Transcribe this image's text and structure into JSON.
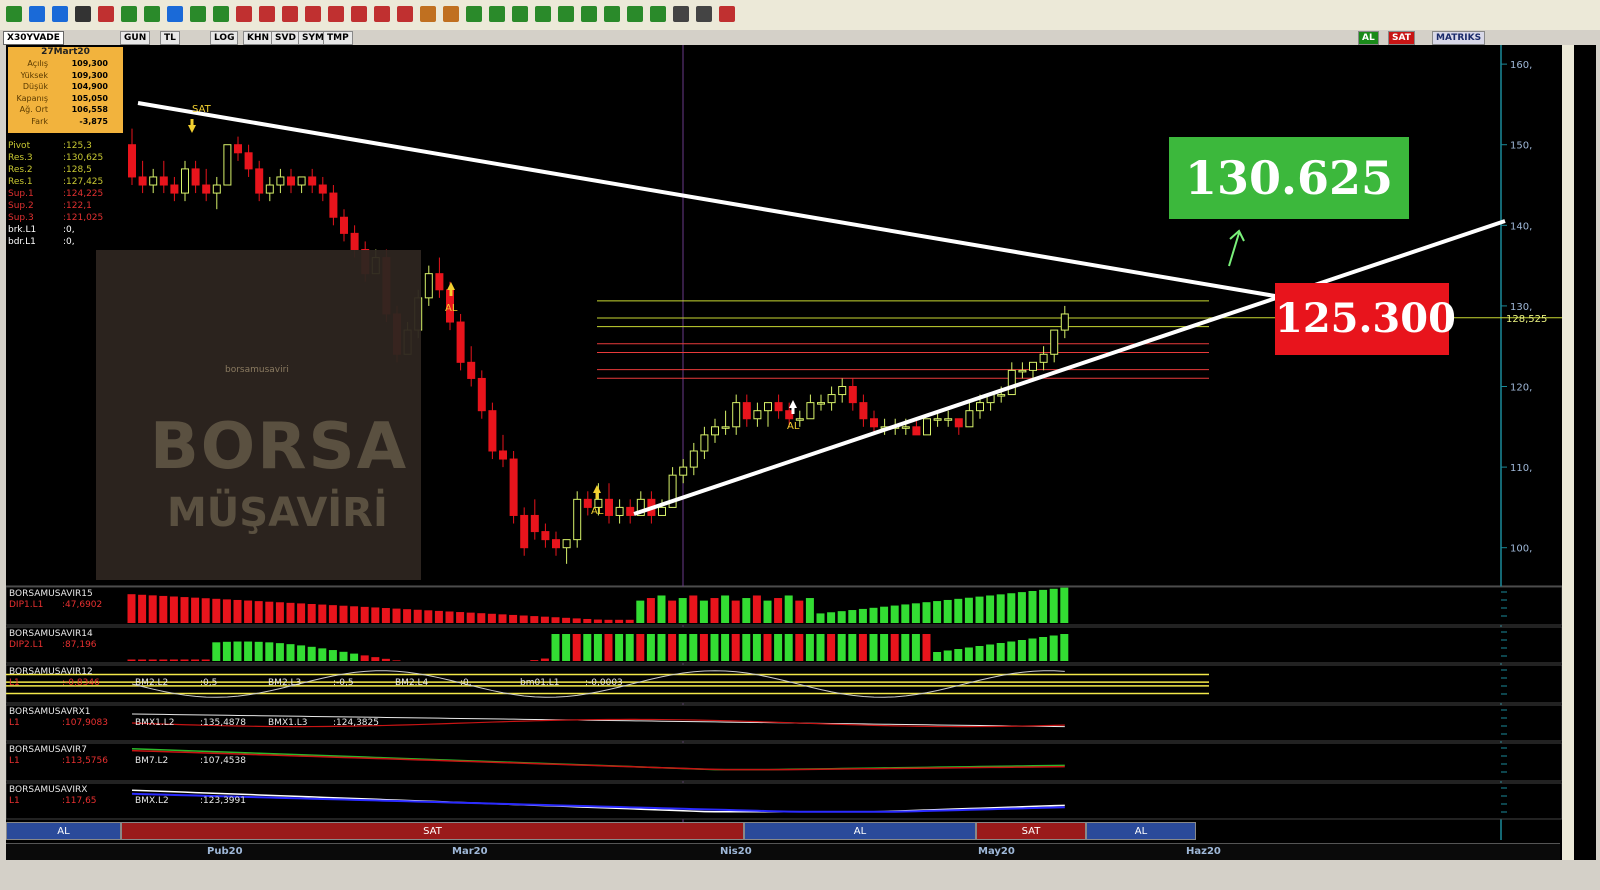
{
  "toolbar": {
    "icon_names": [
      "chart-icon",
      "cursor-icon",
      "crosshair-icon",
      "pencil-icon",
      "tools-icon",
      "trendline-icon",
      "fibonacci-icon",
      "channel-icon",
      "hline-icon",
      "vline-icon",
      "arc-icon",
      "brush-icon",
      "ruler-icon",
      "text-icon",
      "arrow-icon",
      "eraser-icon",
      "zoom-icon",
      "magnet-icon",
      "lock-icon",
      "bell-icon",
      "trash-icon",
      "print-icon",
      "move-icon",
      "grid-icon",
      "reset-icon",
      "left-icon",
      "right-icon",
      "up-icon",
      "down-icon",
      "search-icon",
      "settings-icon",
      "close-icon"
    ]
  },
  "menubar": {
    "symbol": "X30YVADE",
    "buttons": [
      "GUN",
      "TL",
      "LOG",
      "KHN",
      "SVD",
      "SYM",
      "TMP"
    ],
    "right_buttons": [
      "AL",
      "SAT",
      "MATRIKS"
    ]
  },
  "infobox": {
    "date": "27Mart20",
    "rows": [
      {
        "k": "Açılış",
        "v": "109,300"
      },
      {
        "k": "Yüksek",
        "v": "109,300"
      },
      {
        "k": "Düşük",
        "v": "104,900"
      },
      {
        "k": "Kapanış",
        "v": "105,050"
      },
      {
        "k": "Ağ. Ort",
        "v": "106,558"
      },
      {
        "k": "Fark",
        "v": "-3,875"
      }
    ]
  },
  "pivots": [
    {
      "k": "Pivot",
      "v": ":125,3",
      "color": "#c8c832"
    },
    {
      "k": "Res.3",
      "v": ":130,625",
      "color": "#c8c832"
    },
    {
      "k": "Res.2",
      "v": ":128,5",
      "color": "#c8c832"
    },
    {
      "k": "Res.1",
      "v": ":127,425",
      "color": "#c8c832"
    },
    {
      "k": "Sup.1",
      "v": ":124,225",
      "color": "#e03030"
    },
    {
      "k": "Sup.2",
      "v": ":122,1",
      "color": "#e03030"
    },
    {
      "k": "Sup.3",
      "v": ":121,025",
      "color": "#e03030"
    },
    {
      "k": "brk.L1",
      "v": ":0,",
      "color": "#ffffff"
    },
    {
      "k": "bdr.L1",
      "v": ":0,",
      "color": "#ffffff"
    }
  ],
  "watermark": {
    "title": "BORSA",
    "subtitle": "MÜŞAVİRİ",
    "site": "borsamusaviri"
  },
  "labels": {
    "resistance": "130.625",
    "support": "125.300",
    "price_tag": "128,525"
  },
  "signals_on_chart": [
    {
      "text": "SAT",
      "type": "sell"
    },
    {
      "text": "AL",
      "type": "buy"
    },
    {
      "text": "AL",
      "type": "buy"
    },
    {
      "text": "AL",
      "type": "buy"
    }
  ],
  "price_axis": [
    "160,",
    "150,",
    "140,",
    "130,",
    "120,",
    "110,",
    "100,"
  ],
  "indicators": [
    {
      "name": "BORSAMUSAVIR15",
      "line": "DIP1.L1",
      "value": ":47,6902"
    },
    {
      "name": "BORSAMUSAVIR14",
      "line": "DIP2.L1",
      "value": ":87,196"
    },
    {
      "name": "BORSAMUSAVIR12",
      "line": "L1",
      "value": ":-0,8346",
      "extra": [
        {
          "k": "BM2.L2",
          "v": ":0,5"
        },
        {
          "k": "BM2.L3",
          "v": ":-0,5"
        },
        {
          "k": "BM2.L4",
          "v": ":0,"
        },
        {
          "k": "bm01.L1",
          "v": ":-0,0003"
        }
      ]
    },
    {
      "name": "BORSAMUSAVRX1",
      "line": "L1",
      "value": ":107,9083",
      "extra": [
        {
          "k": "BMX1.L2",
          "v": ":135,4878"
        },
        {
          "k": "BMX1.L3",
          "v": ":124,3825"
        }
      ]
    },
    {
      "name": "BORSAMUSAVIR7",
      "line": "L1",
      "value": ":113,5756",
      "extra": [
        {
          "k": "BM7.L2",
          "v": ":107,4538"
        }
      ]
    },
    {
      "name": "BORSAMUSAVIRX",
      "line": "L1",
      "value": ":117,65",
      "extra": [
        {
          "k": "BMX.L2",
          "v": ":123,3991"
        }
      ]
    }
  ],
  "signal_bar": [
    {
      "text": "AL",
      "type": "buy"
    },
    {
      "text": "SAT",
      "type": "sell"
    },
    {
      "text": "AL",
      "type": "buy"
    },
    {
      "text": "SAT",
      "type": "sell"
    },
    {
      "text": "AL",
      "type": "buy"
    }
  ],
  "dates": [
    "Pub20",
    "Mar20",
    "Nis20",
    "May20",
    "Haz20"
  ],
  "colors": {
    "up": "#d8f26a",
    "down": "#e8141c",
    "bull": "#33dd33",
    "bear": "#e8141c",
    "buy": "#2a4a9a",
    "sell": "#9a1a1a"
  },
  "chart_data": {
    "type": "candlestick",
    "ylim": [
      95,
      162
    ],
    "candles": [
      {
        "o": 150,
        "h": 152,
        "l": 145,
        "c": 146
      },
      {
        "o": 146,
        "h": 148,
        "l": 144,
        "c": 145
      },
      {
        "o": 145,
        "h": 147,
        "l": 144,
        "c": 146
      },
      {
        "o": 146,
        "h": 148,
        "l": 144,
        "c": 145
      },
      {
        "o": 145,
        "h": 146,
        "l": 143,
        "c": 144
      },
      {
        "o": 144,
        "h": 148,
        "l": 143,
        "c": 147
      },
      {
        "o": 147,
        "h": 148,
        "l": 144,
        "c": 145
      },
      {
        "o": 145,
        "h": 147,
        "l": 143,
        "c": 144
      },
      {
        "o": 144,
        "h": 146,
        "l": 142,
        "c": 145
      },
      {
        "o": 145,
        "h": 150,
        "l": 145,
        "c": 150
      },
      {
        "o": 150,
        "h": 151,
        "l": 148,
        "c": 149
      },
      {
        "o": 149,
        "h": 150,
        "l": 146,
        "c": 147
      },
      {
        "o": 147,
        "h": 148,
        "l": 143,
        "c": 144
      },
      {
        "o": 144,
        "h": 146,
        "l": 143,
        "c": 145
      },
      {
        "o": 145,
        "h": 147,
        "l": 144,
        "c": 146
      },
      {
        "o": 146,
        "h": 147,
        "l": 144,
        "c": 145
      },
      {
        "o": 145,
        "h": 146,
        "l": 144,
        "c": 146
      },
      {
        "o": 146,
        "h": 147,
        "l": 144,
        "c": 145
      },
      {
        "o": 145,
        "h": 146,
        "l": 143,
        "c": 144
      },
      {
        "o": 144,
        "h": 145,
        "l": 140,
        "c": 141
      },
      {
        "o": 141,
        "h": 142,
        "l": 138,
        "c": 139
      },
      {
        "o": 139,
        "h": 140,
        "l": 136,
        "c": 137
      },
      {
        "o": 137,
        "h": 138,
        "l": 133,
        "c": 134
      },
      {
        "o": 134,
        "h": 137,
        "l": 134,
        "c": 136
      },
      {
        "o": 136,
        "h": 137,
        "l": 128,
        "c": 129
      },
      {
        "o": 129,
        "h": 130,
        "l": 123,
        "c": 124
      },
      {
        "o": 124,
        "h": 128,
        "l": 124,
        "c": 127
      },
      {
        "o": 127,
        "h": 132,
        "l": 126,
        "c": 131
      },
      {
        "o": 131,
        "h": 135,
        "l": 130,
        "c": 134
      },
      {
        "o": 134,
        "h": 136,
        "l": 131,
        "c": 132
      },
      {
        "o": 132,
        "h": 133,
        "l": 127,
        "c": 128
      },
      {
        "o": 128,
        "h": 129,
        "l": 122,
        "c": 123
      },
      {
        "o": 123,
        "h": 125,
        "l": 120,
        "c": 121
      },
      {
        "o": 121,
        "h": 122,
        "l": 116,
        "c": 117
      },
      {
        "o": 117,
        "h": 118,
        "l": 111,
        "c": 112
      },
      {
        "o": 112,
        "h": 114,
        "l": 110,
        "c": 111
      },
      {
        "o": 111,
        "h": 112,
        "l": 103,
        "c": 104
      },
      {
        "o": 104,
        "h": 105,
        "l": 99,
        "c": 100
      },
      {
        "o": 104,
        "h": 106,
        "l": 101,
        "c": 102
      },
      {
        "o": 102,
        "h": 103,
        "l": 100,
        "c": 101
      },
      {
        "o": 101,
        "h": 102,
        "l": 99,
        "c": 100
      },
      {
        "o": 100,
        "h": 101,
        "l": 98,
        "c": 101
      },
      {
        "o": 101,
        "h": 107,
        "l": 100,
        "c": 106
      },
      {
        "o": 106,
        "h": 107,
        "l": 104,
        "c": 105
      },
      {
        "o": 105,
        "h": 108,
        "l": 104,
        "c": 106
      },
      {
        "o": 106,
        "h": 108,
        "l": 103,
        "c": 104
      },
      {
        "o": 104,
        "h": 106,
        "l": 103,
        "c": 105
      },
      {
        "o": 105,
        "h": 106,
        "l": 103,
        "c": 104
      },
      {
        "o": 104,
        "h": 107,
        "l": 104,
        "c": 106
      },
      {
        "o": 106,
        "h": 107,
        "l": 103,
        "c": 104
      },
      {
        "o": 104,
        "h": 106,
        "l": 104,
        "c": 105
      },
      {
        "o": 105,
        "h": 110,
        "l": 105,
        "c": 109
      },
      {
        "o": 109,
        "h": 111,
        "l": 108,
        "c": 110
      },
      {
        "o": 110,
        "h": 113,
        "l": 109,
        "c": 112
      },
      {
        "o": 112,
        "h": 115,
        "l": 111,
        "c": 114
      },
      {
        "o": 114,
        "h": 116,
        "l": 113,
        "c": 115
      },
      {
        "o": 115,
        "h": 117,
        "l": 114,
        "c": 115
      },
      {
        "o": 115,
        "h": 119,
        "l": 114,
        "c": 118
      },
      {
        "o": 118,
        "h": 119,
        "l": 115,
        "c": 116
      },
      {
        "o": 116,
        "h": 118,
        "l": 115,
        "c": 117
      },
      {
        "o": 117,
        "h": 118,
        "l": 115,
        "c": 118
      },
      {
        "o": 118,
        "h": 119,
        "l": 116,
        "c": 117
      },
      {
        "o": 117,
        "h": 118,
        "l": 115,
        "c": 116
      },
      {
        "o": 116,
        "h": 117,
        "l": 115,
        "c": 116
      },
      {
        "o": 116,
        "h": 119,
        "l": 116,
        "c": 118
      },
      {
        "o": 118,
        "h": 119,
        "l": 117,
        "c": 118
      },
      {
        "o": 118,
        "h": 120,
        "l": 117,
        "c": 119
      },
      {
        "o": 119,
        "h": 121,
        "l": 118,
        "c": 120
      },
      {
        "o": 120,
        "h": 121,
        "l": 117,
        "c": 118
      },
      {
        "o": 118,
        "h": 119,
        "l": 115,
        "c": 116
      },
      {
        "o": 116,
        "h": 117,
        "l": 114,
        "c": 115
      },
      {
        "o": 115,
        "h": 116,
        "l": 114,
        "c": 115
      },
      {
        "o": 115,
        "h": 116,
        "l": 114,
        "c": 115
      },
      {
        "o": 115,
        "h": 116,
        "l": 114,
        "c": 115
      },
      {
        "o": 115,
        "h": 116,
        "l": 114,
        "c": 114
      },
      {
        "o": 114,
        "h": 116,
        "l": 114,
        "c": 116
      },
      {
        "o": 116,
        "h": 117,
        "l": 115,
        "c": 116
      },
      {
        "o": 116,
        "h": 117,
        "l": 115,
        "c": 116
      },
      {
        "o": 116,
        "h": 116,
        "l": 114,
        "c": 115
      },
      {
        "o": 115,
        "h": 118,
        "l": 115,
        "c": 117
      },
      {
        "o": 117,
        "h": 119,
        "l": 116,
        "c": 118
      },
      {
        "o": 118,
        "h": 119,
        "l": 117,
        "c": 119
      },
      {
        "o": 119,
        "h": 120,
        "l": 118,
        "c": 119
      },
      {
        "o": 119,
        "h": 123,
        "l": 119,
        "c": 122
      },
      {
        "o": 122,
        "h": 123,
        "l": 121,
        "c": 122
      },
      {
        "o": 122,
        "h": 123,
        "l": 121,
        "c": 123
      },
      {
        "o": 123,
        "h": 125,
        "l": 122,
        "c": 124
      },
      {
        "o": 124,
        "h": 127,
        "l": 123,
        "c": 127
      },
      {
        "o": 127,
        "h": 130,
        "l": 126,
        "c": 129
      }
    ],
    "pivot_levels": [
      130.625,
      128.5,
      127.425,
      125.3,
      124.225,
      122.1,
      121.025
    ],
    "trendline_down": [
      {
        "x": 138,
        "y": 103
      },
      {
        "x": 1275,
        "y": 296
      }
    ],
    "trendline_up": [
      {
        "x": 634,
        "y": 514
      },
      {
        "x": 1505,
        "y": 221
      }
    ]
  }
}
